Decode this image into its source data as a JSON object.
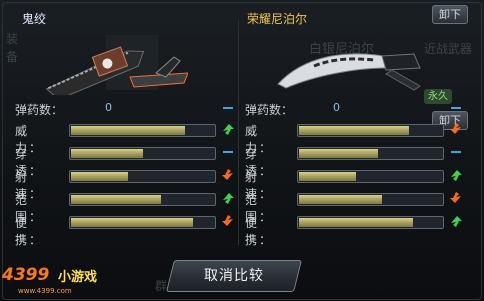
{
  "left": {
    "weapon_name": "鬼绞",
    "ammo_label": "弹药数：",
    "ammo_value": "0",
    "stats": [
      {
        "label": "威 力：",
        "fill": 0.8,
        "indicator": "up"
      },
      {
        "label": "穿 透：",
        "fill": 0.5,
        "indicator": "equal"
      },
      {
        "label": "射 速：",
        "fill": 0.4,
        "indicator": "down"
      },
      {
        "label": "范 围：",
        "fill": 0.63,
        "indicator": "up"
      },
      {
        "label": "便 携：",
        "fill": 0.85,
        "indicator": "down"
      }
    ]
  },
  "right": {
    "weapon_name": "荣耀尼泊尔",
    "ammo_label": "弹药数：",
    "ammo_value": "0",
    "stats": [
      {
        "label": "威 力：",
        "fill": 0.77,
        "indicator": "down"
      },
      {
        "label": "穿 透：",
        "fill": 0.55,
        "indicator": "equal"
      },
      {
        "label": "射 速：",
        "fill": 0.4,
        "indicator": "up"
      },
      {
        "label": "范 围：",
        "fill": 0.58,
        "indicator": "down"
      },
      {
        "label": "便 携：",
        "fill": 0.8,
        "indicator": "up"
      }
    ]
  },
  "background": {
    "weapon_text": "白银尼泊尔",
    "category_text": "近战武器",
    "badge": "永久",
    "side_left": "装",
    "side_left2": "备",
    "bottom_text": "群"
  },
  "buttons": {
    "unequip_label": "卸下",
    "cancel_compare": "取消比较"
  },
  "logo": {
    "main": "4399",
    "cn": "小游戏",
    "sub": "www.4399.com"
  },
  "colors": {
    "up": "#3fd04f",
    "down": "#ff6a1a",
    "equal": "#3aa7e0",
    "weapon_name": "#e8e8ff",
    "weapon_name_right": "#f2c64c"
  }
}
